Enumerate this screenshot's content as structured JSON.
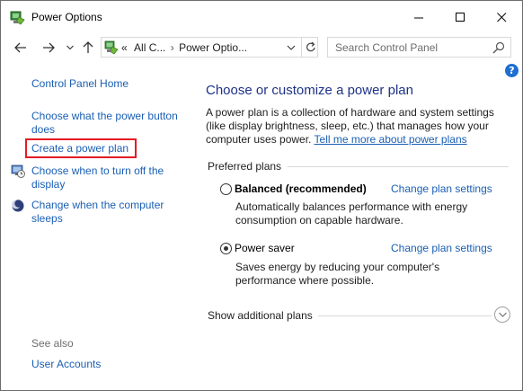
{
  "window": {
    "title": "Power Options",
    "icons": {
      "app": "power-options-icon",
      "minimize": "minimize-icon",
      "maximize": "maximize-icon",
      "close": "close-icon"
    }
  },
  "nav": {
    "back_icon": "arrow-left-icon",
    "forward_icon": "arrow-right-icon",
    "recent_icon": "chevron-down-icon",
    "up_icon": "arrow-up-icon",
    "breadcrumb": {
      "prefix": "«",
      "items": [
        "All C...",
        "Power Optio..."
      ],
      "separator": "›"
    },
    "search": {
      "placeholder": "Search Control Panel"
    }
  },
  "sidebar": {
    "home": "Control Panel Home",
    "links": [
      {
        "label": "Choose what the power button does"
      },
      {
        "label": "Create a power plan"
      },
      {
        "label": "Choose when to turn off the display",
        "icon": "monitor-clock-icon"
      },
      {
        "label": "Change when the computer sleeps",
        "icon": "moon-icon"
      }
    ],
    "see_also": {
      "title": "See also",
      "links": [
        "User Accounts"
      ]
    }
  },
  "main": {
    "heading": "Choose or customize a power plan",
    "description": "A power plan is a collection of hardware and system settings (like display brightness, sleep, etc.) that manages how your computer uses power.",
    "description_link": "Tell me more about power plans",
    "preferred_label": "Preferred plans",
    "plans": [
      {
        "name": "Balanced (recommended)",
        "selected": false,
        "change": "Change plan settings",
        "description": "Automatically balances performance with energy consumption on capable hardware."
      },
      {
        "name": "Power saver",
        "selected": true,
        "change": "Change plan settings",
        "description": "Saves energy by reducing your computer's performance where possible."
      }
    ],
    "additional": "Show additional plans"
  },
  "colors": {
    "link": "#1a5fb4",
    "heading": "#1e3287",
    "highlight": "#e31b23",
    "help": "#1e6fd0"
  }
}
